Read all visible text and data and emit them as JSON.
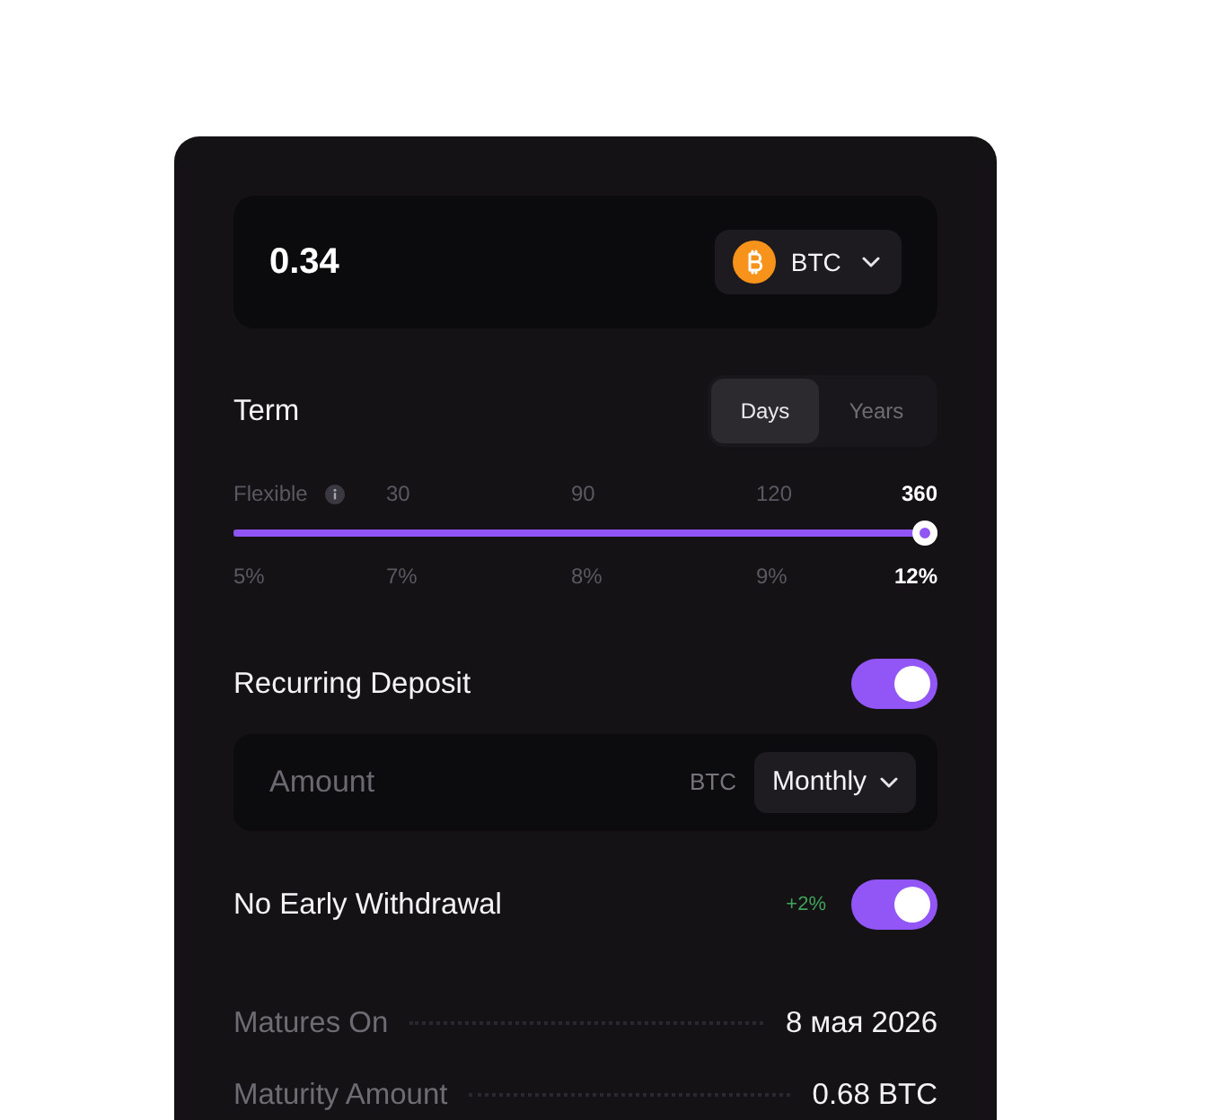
{
  "amount": {
    "value": "0.34",
    "currency": "BTC"
  },
  "term": {
    "label": "Term",
    "units": [
      {
        "label": "Days",
        "selected": true
      },
      {
        "label": "Years",
        "selected": false
      }
    ]
  },
  "slider": {
    "stops": [
      {
        "label": "Flexible",
        "rate": "5%",
        "info_icon": true,
        "selected": false
      },
      {
        "label": "30",
        "rate": "7%",
        "info_icon": false,
        "selected": false
      },
      {
        "label": "90",
        "rate": "8%",
        "info_icon": false,
        "selected": false
      },
      {
        "label": "120",
        "rate": "9%",
        "info_icon": false,
        "selected": false
      },
      {
        "label": "360",
        "rate": "12%",
        "info_icon": false,
        "selected": true
      }
    ],
    "level": 1
  },
  "recurring_deposit": {
    "label": "Recurring Deposit",
    "on": true,
    "amount": {
      "placeholder": "Amount",
      "currency": "BTC",
      "frequency": "Monthly"
    }
  },
  "no_early_withdrawal": {
    "label": "No Early Withdrawal",
    "bonus": "+2%",
    "on": true
  },
  "summary": [
    {
      "label": "Matures On",
      "value": "8 мая 2026"
    },
    {
      "label": "Maturity Amount",
      "value": "0.68 BTC"
    }
  ]
}
